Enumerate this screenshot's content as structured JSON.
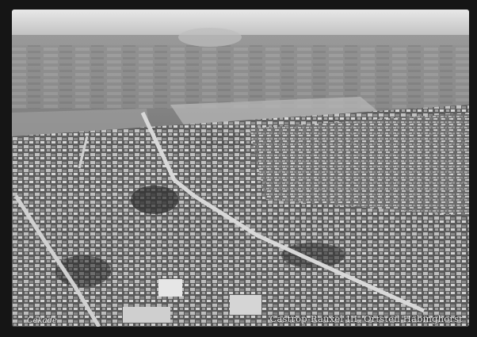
{
  "photo": {
    "caption": "Castrop-Rauxel III, Ortsteil Habinghorst",
    "publisher_logo": "Cekade"
  }
}
